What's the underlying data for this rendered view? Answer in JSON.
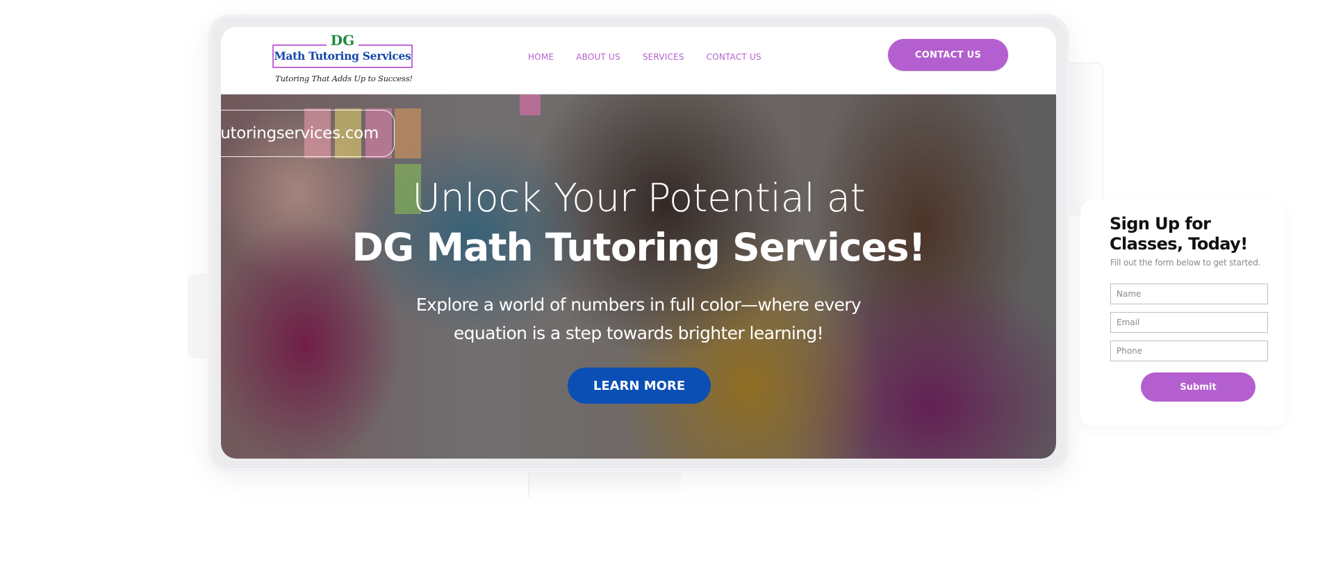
{
  "logo": {
    "initials": "DG",
    "name": "Math Tutoring Services",
    "tagline": "Tutoring That Adds Up to Success!"
  },
  "nav": {
    "items": [
      {
        "label": "HOME"
      },
      {
        "label": "ABOUT US"
      },
      {
        "label": "SERVICES"
      },
      {
        "label": "CONTACT US"
      }
    ],
    "cta_label": "CONTACT US"
  },
  "hero": {
    "url_text": "mathtutoringservices.com",
    "headline_line1": "Unlock Your Potential at",
    "headline_line2": "DG Math Tutoring Services!",
    "subheadline": "Explore a world of numbers in full color—where every equation is a step towards brighter learning!",
    "button_label": "LEARN MORE"
  },
  "signup": {
    "title": "Sign Up for Classes, Today!",
    "subtitle": "Fill out the form below to get started.",
    "fields": [
      {
        "placeholder": "Name",
        "value": ""
      },
      {
        "placeholder": "Email",
        "value": ""
      },
      {
        "placeholder": "Phone",
        "value": ""
      }
    ],
    "submit_label": "Submit"
  },
  "colors": {
    "accent_purple": "#b45fcf",
    "primary_blue": "#0b4fb5",
    "logo_green": "#1f8a3f",
    "logo_blue": "#1446a8"
  }
}
